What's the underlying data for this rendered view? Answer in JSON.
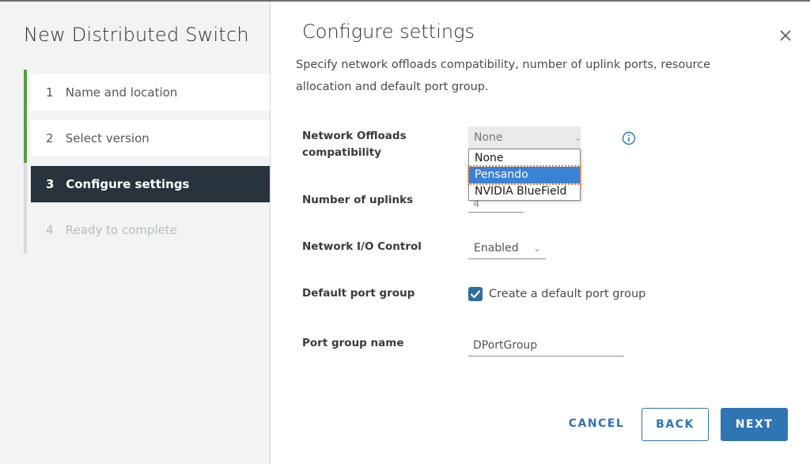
{
  "wizard": {
    "title": "New Distributed Switch",
    "steps": [
      {
        "num": "1",
        "label": "Name and location"
      },
      {
        "num": "2",
        "label": "Select version"
      },
      {
        "num": "3",
        "label": "Configure settings"
      },
      {
        "num": "4",
        "label": "Ready to complete"
      }
    ]
  },
  "content": {
    "title": "Configure settings",
    "description_line1": "Specify network offloads compatibility, number of uplink ports, resource",
    "description_line2": "allocation and default port group."
  },
  "form": {
    "offloads": {
      "label_line1": "Network Offloads",
      "label_line2": "compatibility",
      "selected": "None",
      "options": [
        "None",
        "Pensando",
        "NVIDIA BlueField"
      ],
      "highlighted": "Pensando"
    },
    "uplinks": {
      "label": "Number of uplinks",
      "value": "4"
    },
    "nioc": {
      "label": "Network I/O Control",
      "value": "Enabled"
    },
    "default_port_group": {
      "label": "Default port group",
      "checkbox_label": "Create a default port group",
      "checked": true
    },
    "port_group_name": {
      "label": "Port group name",
      "value": "DPortGroup"
    }
  },
  "buttons": {
    "cancel": "CANCEL",
    "back": "BACK",
    "next": "NEXT"
  },
  "colors": {
    "accent": "#2f74b3",
    "active_step": "#27343d",
    "done_bar": "#5a9a3f",
    "highlight": "#3a82d6"
  }
}
